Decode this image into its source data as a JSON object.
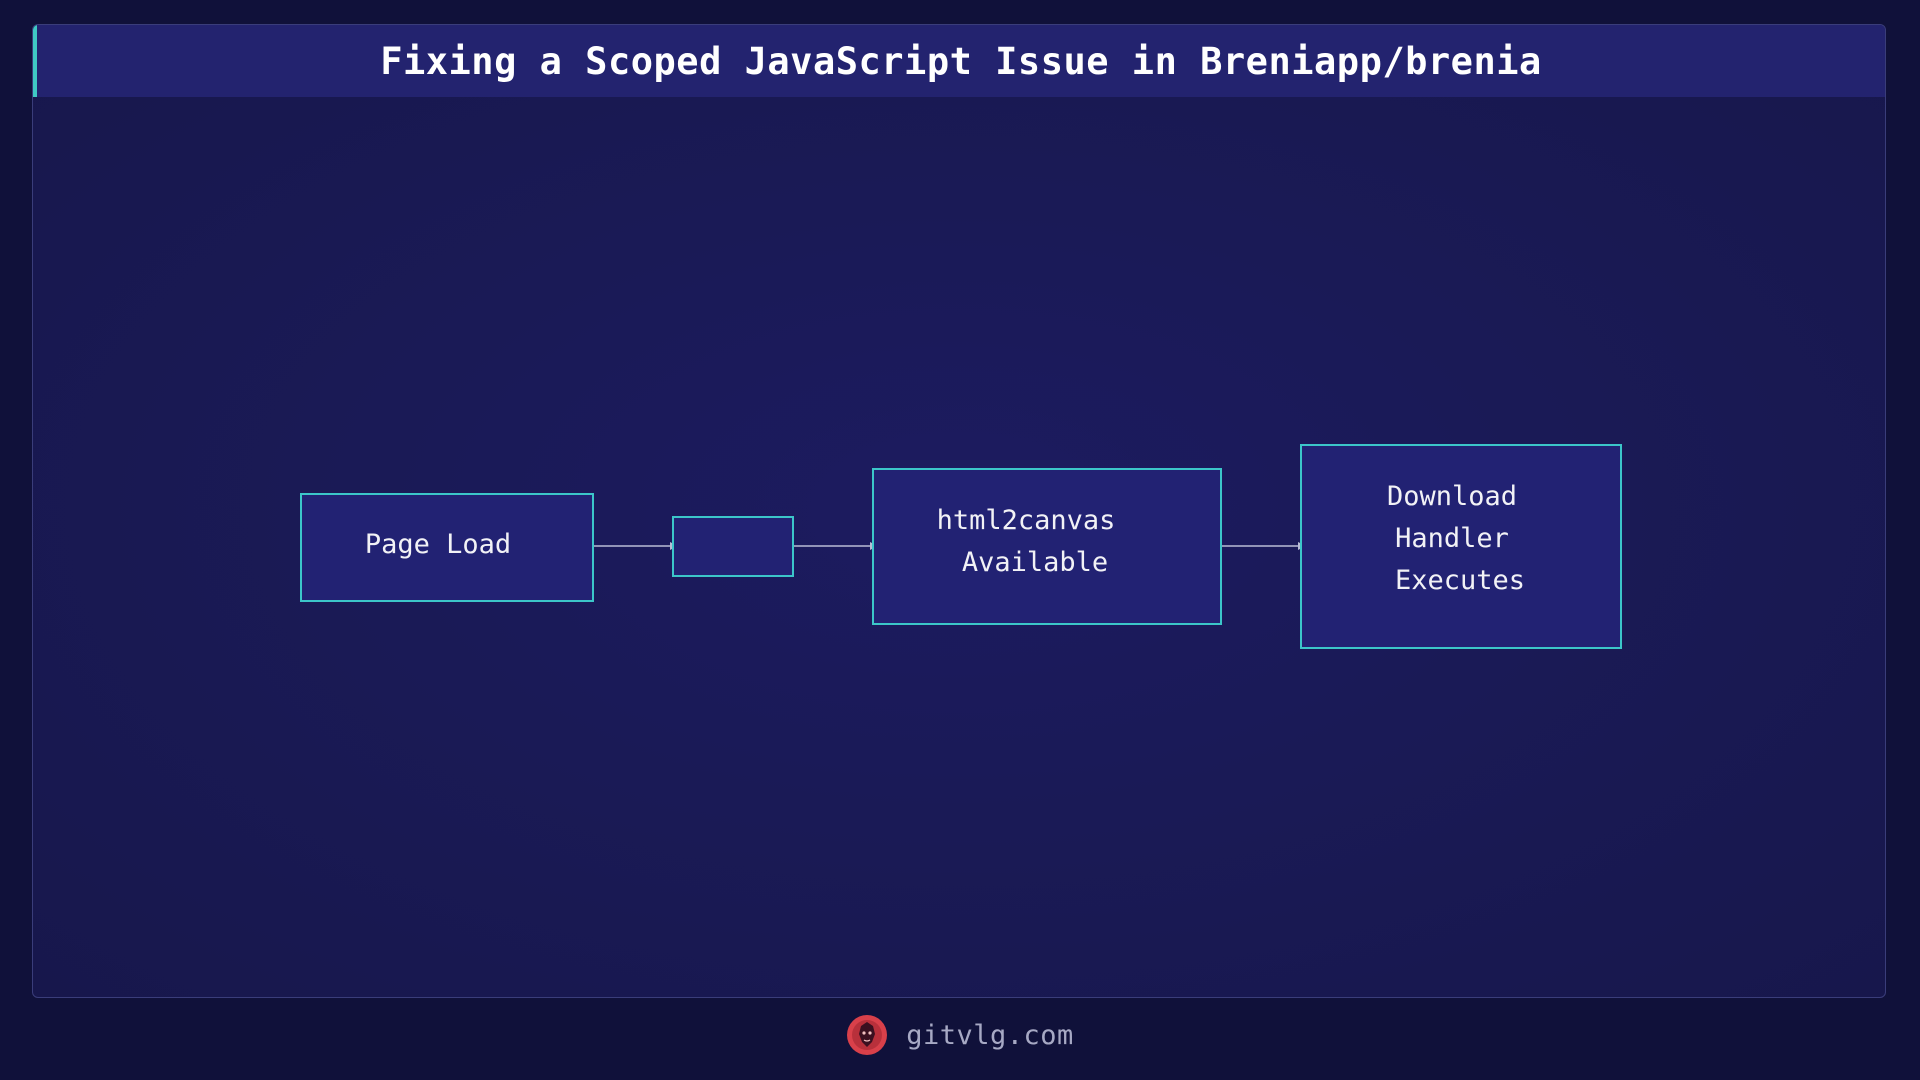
{
  "title": "Fixing a Scoped JavaScript Issue in Breniapp/brenia",
  "diagram": {
    "nodes": [
      {
        "id": "page-load",
        "lines": [
          "Page Load"
        ]
      },
      {
        "id": "empty",
        "lines": []
      },
      {
        "id": "html2canvas-available",
        "lines": [
          "html2canvas",
          "Available"
        ]
      },
      {
        "id": "download-handler-executes",
        "lines": [
          "Download",
          "Handler",
          "Executes"
        ]
      }
    ],
    "edges": [
      {
        "from": "page-load",
        "to": "empty"
      },
      {
        "from": "empty",
        "to": "html2canvas-available"
      },
      {
        "from": "html2canvas-available",
        "to": "download-handler-executes"
      }
    ]
  },
  "footer": {
    "site": "gitvlg.com",
    "logo_icon": "lion-head-icon"
  },
  "colors": {
    "background": "#10113a",
    "panel": "#1b1a5a",
    "title_bar": "#23236f",
    "accent": "#3fc9c4",
    "node_fill": "#222273",
    "node_stroke": "#3cc6c9",
    "arrow": "#b9bcd6",
    "logo": "#d9404a"
  }
}
